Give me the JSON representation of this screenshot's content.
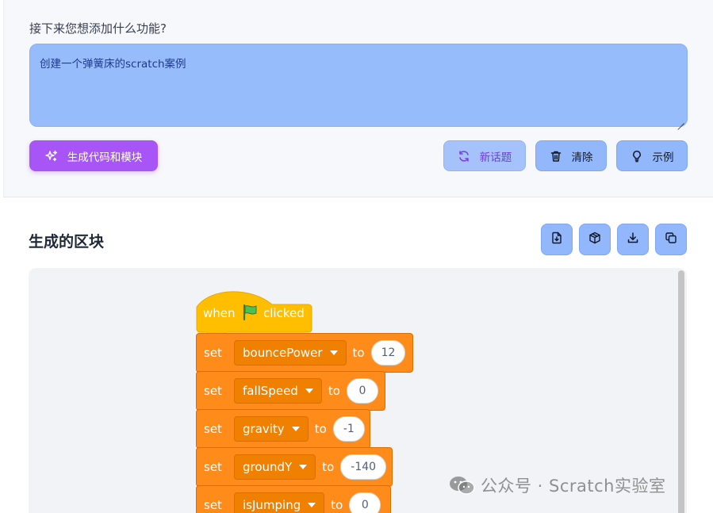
{
  "prompt": {
    "label": "接下来您想添加什么功能?",
    "value": "创建一个弹簧床的scratch案例"
  },
  "actions": {
    "generate_label": "生成代码和模块",
    "new_topic_label": "新话题",
    "clear_label": "清除",
    "example_label": "示例"
  },
  "result": {
    "title": "生成的区块",
    "tools": [
      "import-icon",
      "package-icon",
      "download-icon",
      "copy-icon"
    ]
  },
  "blocks": {
    "hat": {
      "when": "when",
      "clicked": "clicked"
    },
    "sets": [
      {
        "kw": "set",
        "var": "bouncePower",
        "to": "to",
        "value": "12"
      },
      {
        "kw": "set",
        "var": "fallSpeed",
        "to": "to",
        "value": "0"
      },
      {
        "kw": "set",
        "var": "gravity",
        "to": "to",
        "value": "-1"
      },
      {
        "kw": "set",
        "var": "groundY",
        "to": "to",
        "value": "-140"
      },
      {
        "kw": "set",
        "var": "isJumping",
        "to": "to",
        "value": "0"
      }
    ]
  },
  "watermark": "公众号 · Scratch实验室",
  "colors": {
    "generate": "#a855f7",
    "prompt_bg": "#97bcfb",
    "tool_btn": "#93b7fb",
    "event_block": "#ffbf00",
    "variable_block": "#ff8c1a"
  }
}
